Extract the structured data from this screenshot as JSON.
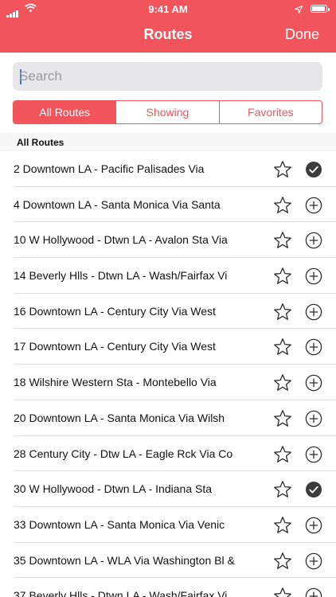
{
  "status": {
    "time": "9:41 AM"
  },
  "nav": {
    "title": "Routes",
    "done_label": "Done"
  },
  "search": {
    "placeholder": "Search",
    "value": ""
  },
  "tabs": [
    {
      "label": "All Routes",
      "active": true
    },
    {
      "label": "Showing",
      "active": false
    },
    {
      "label": "Favorites",
      "active": false
    }
  ],
  "section_title": "All Routes",
  "routes": [
    {
      "label": "2  Downtown LA - Pacific Palisades Via",
      "favorite": false,
      "showing": true
    },
    {
      "label": "4  Downtown LA - Santa Monica Via Santa",
      "favorite": false,
      "showing": false
    },
    {
      "label": "10  W Hollywood - Dtwn LA - Avalon Sta Via",
      "favorite": false,
      "showing": false
    },
    {
      "label": "14  Beverly Hlls - Dtwn LA - Wash/Fairfax Vi",
      "favorite": false,
      "showing": false
    },
    {
      "label": "16  Downtown LA - Century City Via West",
      "favorite": false,
      "showing": false
    },
    {
      "label": "17  Downtown LA - Century City Via West",
      "favorite": false,
      "showing": false
    },
    {
      "label": "18  Wilshire Western Sta - Montebello Via",
      "favorite": false,
      "showing": false
    },
    {
      "label": "20  Downtown LA - Santa Monica Via Wilsh",
      "favorite": false,
      "showing": false
    },
    {
      "label": "28  Century City - Dtw LA - Eagle Rck Via Co",
      "favorite": false,
      "showing": false
    },
    {
      "label": "30  W Hollywood - Dtwn LA - Indiana Sta",
      "favorite": false,
      "showing": true
    },
    {
      "label": "33  Downtown LA - Santa Monica Via Venic",
      "favorite": false,
      "showing": false
    },
    {
      "label": "35  Downtown LA - WLA Via Washington Bl &",
      "favorite": false,
      "showing": false
    },
    {
      "label": "37  Beverly Hlls - Dtwn LA - Wash/Fairfax Vi",
      "favorite": false,
      "showing": false
    }
  ],
  "icons": {
    "favorite": "star-outline-icon",
    "add": "plus-circle-icon",
    "added": "check-circle-icon"
  },
  "colors": {
    "accent": "#f2545b",
    "check_fill": "#3c3c3c"
  }
}
